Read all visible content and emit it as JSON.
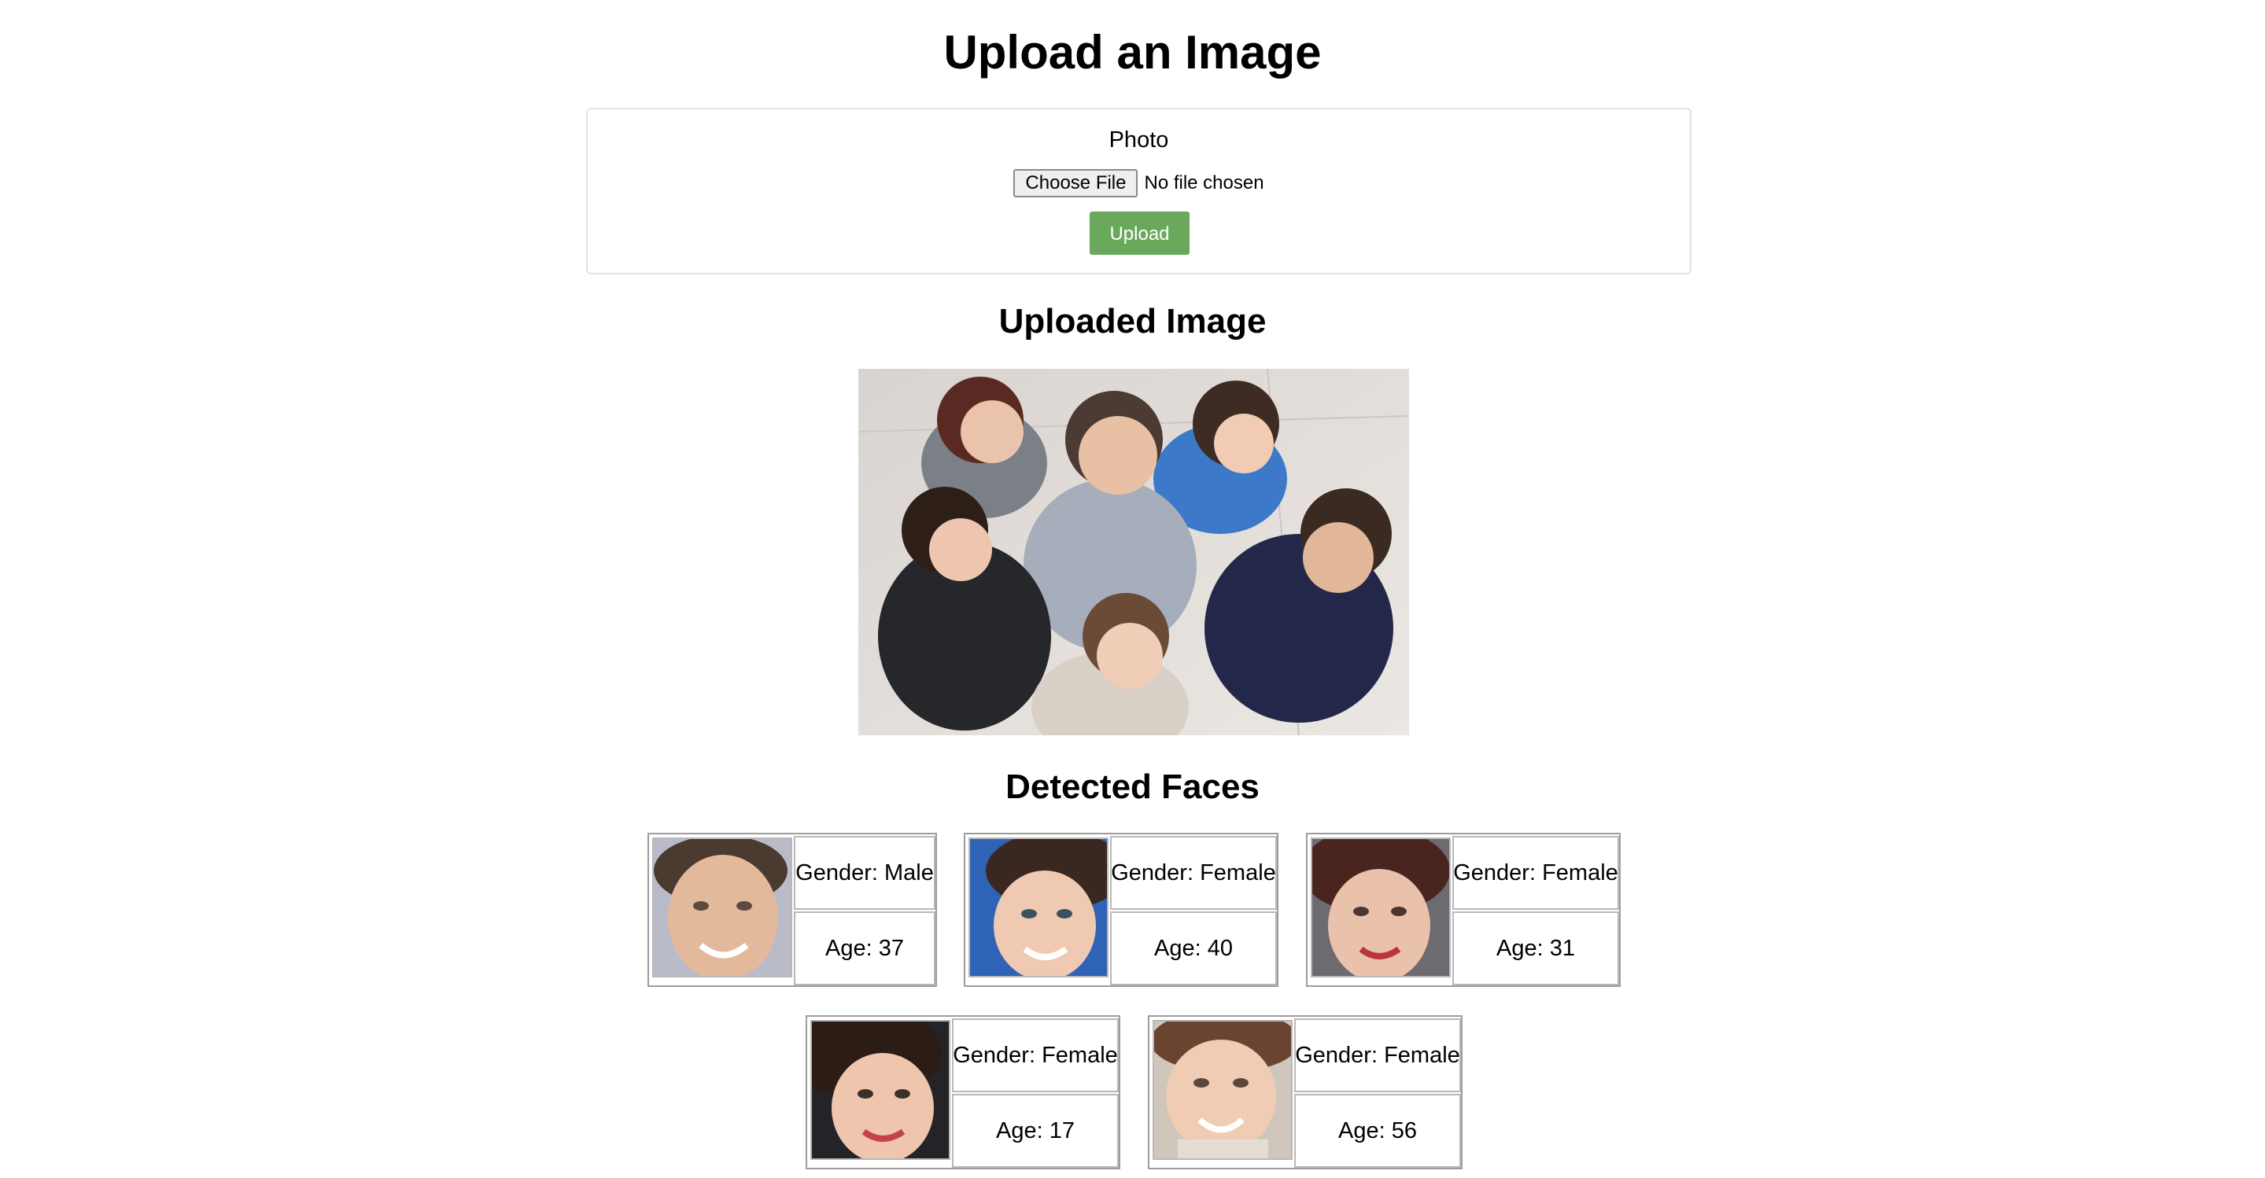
{
  "page": {
    "title": "Upload an Image"
  },
  "upload_form": {
    "photo_label": "Photo",
    "choose_file_label": "Choose File",
    "file_status": "No file chosen",
    "upload_label": "Upload"
  },
  "uploaded_section": {
    "heading": "Uploaded Image"
  },
  "faces_section": {
    "heading": "Detected Faces",
    "faces": [
      {
        "gender": "Gender: Male",
        "age": "Age: 37"
      },
      {
        "gender": "Gender: Female",
        "age": "Age: 40"
      },
      {
        "gender": "Gender: Female",
        "age": "Age: 31"
      },
      {
        "gender": "Gender: Female",
        "age": "Age: 17"
      },
      {
        "gender": "Gender: Female",
        "age": "Age: 56"
      }
    ]
  },
  "colors": {
    "upload_button": "#6aa85c",
    "card_border": "#e3e3e3"
  }
}
